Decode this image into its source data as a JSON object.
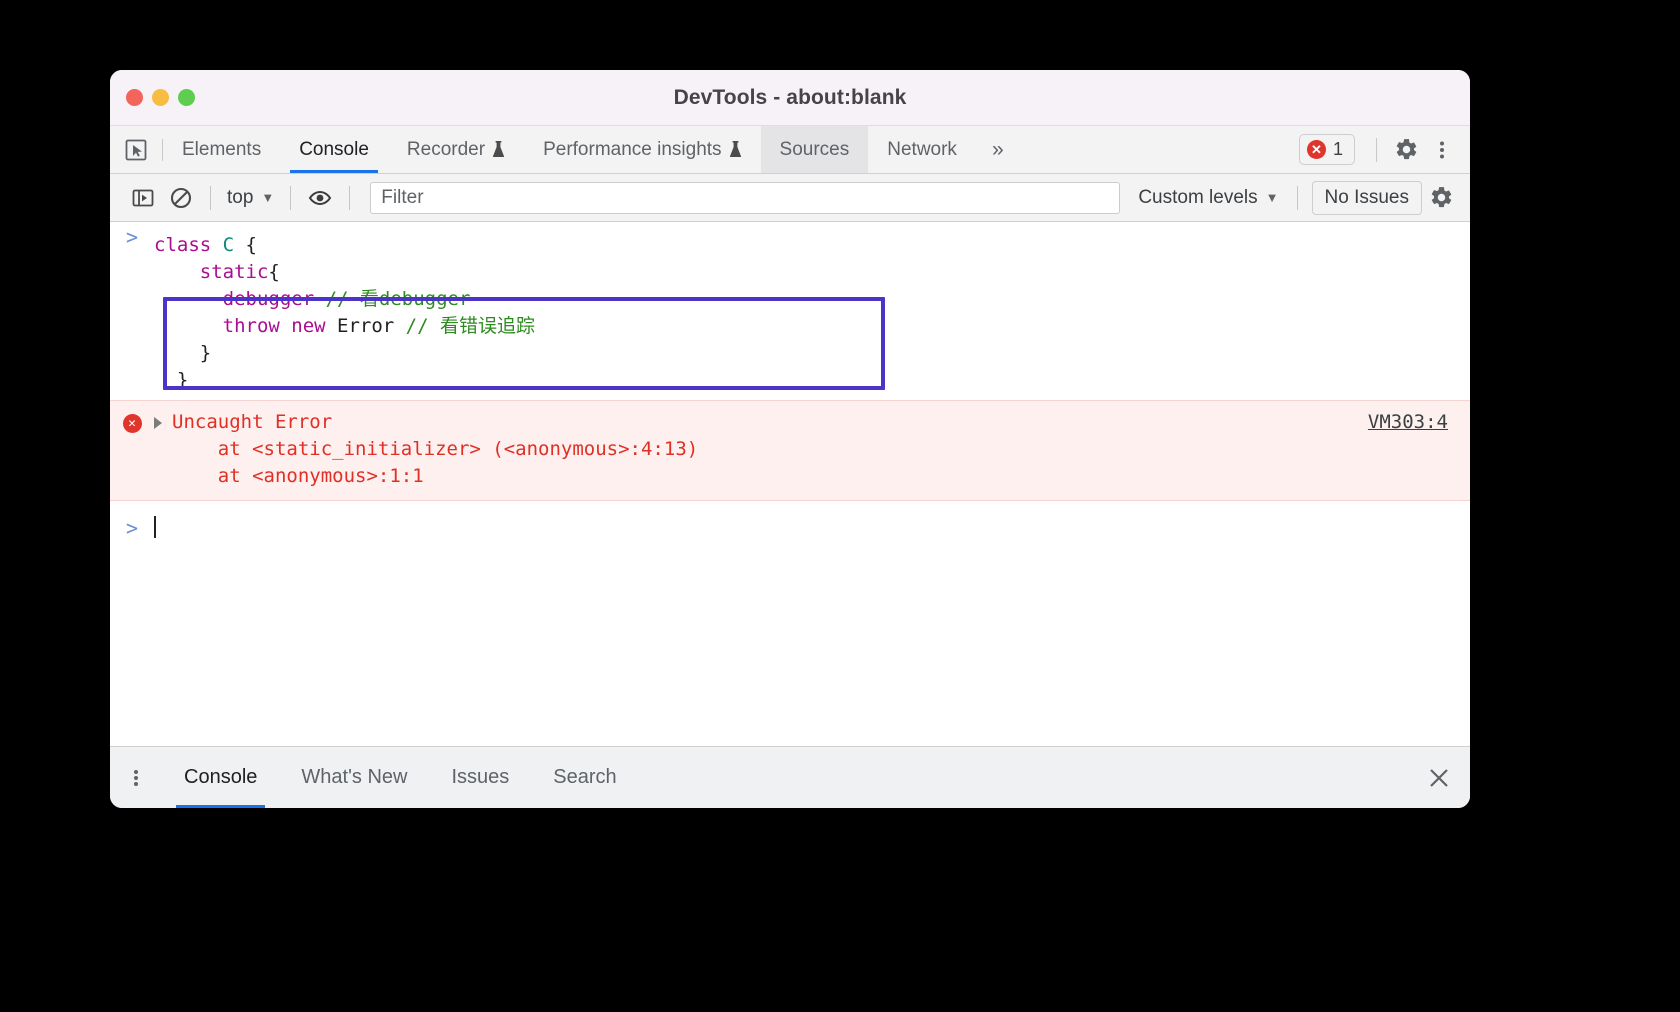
{
  "window": {
    "title": "DevTools - about:blank",
    "traffic_lights": [
      "close",
      "minimize",
      "maximize"
    ]
  },
  "main_tabs": {
    "inspect_icon": "inspect-cursor-icon",
    "items": [
      {
        "label": "Elements",
        "selected": false,
        "experimental": false
      },
      {
        "label": "Console",
        "selected": true,
        "experimental": false
      },
      {
        "label": "Recorder",
        "selected": false,
        "experimental": true
      },
      {
        "label": "Performance insights",
        "selected": false,
        "experimental": true
      },
      {
        "label": "Sources",
        "selected": false,
        "experimental": false,
        "hovered": true
      },
      {
        "label": "Network",
        "selected": false,
        "experimental": false
      }
    ],
    "overflow_label": "»",
    "error_badge": {
      "icon": "error-circle-icon",
      "count": "1"
    },
    "settings_icon": "gear-icon",
    "more_icon": "kebab-menu-icon"
  },
  "console_toolbar": {
    "sidebar_toggle_icon": "console-sidebar-icon",
    "clear_icon": "clear-console-icon",
    "context_label": "top",
    "eye_icon": "live-expression-icon",
    "filter_placeholder": "Filter",
    "filter_value": "",
    "levels_label": "Custom levels",
    "issues_label": "No Issues",
    "settings_icon": "gear-icon"
  },
  "console": {
    "input_echo": {
      "prompt": ">",
      "lines": [
        [
          {
            "t": "class ",
            "c": "kw"
          },
          {
            "t": "C",
            "c": "cls"
          },
          {
            "t": " {",
            "c": "plain"
          }
        ],
        [
          {
            "t": "    static",
            "c": "kw"
          },
          {
            "t": "{",
            "c": "plain"
          }
        ],
        [
          {
            "t": "      debugger",
            "c": "kw"
          },
          {
            "t": " ",
            "c": "plain"
          },
          {
            "t": "// 看debugger",
            "c": "cmt"
          }
        ],
        [
          {
            "t": "      throw new ",
            "c": "kw"
          },
          {
            "t": "Error ",
            "c": "plain"
          },
          {
            "t": "// 看错误追踪",
            "c": "cmt"
          }
        ],
        [
          {
            "t": "    }",
            "c": "plain"
          }
        ],
        [
          {
            "t": "  }",
            "c": "plain"
          }
        ]
      ]
    },
    "error_message": {
      "icon": "error-circle-icon",
      "disclosure": "expand-triangle-icon",
      "title": "Uncaught Error",
      "stack": [
        "    at <static_initializer> (<anonymous>:4:13)",
        "    at <anonymous>:1:1"
      ],
      "source_link": "VM303:4"
    },
    "prompt": {
      "chevron": ">",
      "value": ""
    },
    "annotation": {
      "color": "#4b34c8",
      "shape": "rectangle"
    }
  },
  "drawer": {
    "menu_icon": "kebab-menu-icon",
    "tabs": [
      {
        "label": "Console",
        "selected": true
      },
      {
        "label": "What's New",
        "selected": false
      },
      {
        "label": "Issues",
        "selected": false
      },
      {
        "label": "Search",
        "selected": false
      }
    ],
    "close_icon": "close-icon"
  },
  "colors": {
    "accent": "#1a73e8",
    "error": "#e0352b",
    "annotation": "#4b34c8",
    "error_row_bg": "#fdf0ef"
  }
}
